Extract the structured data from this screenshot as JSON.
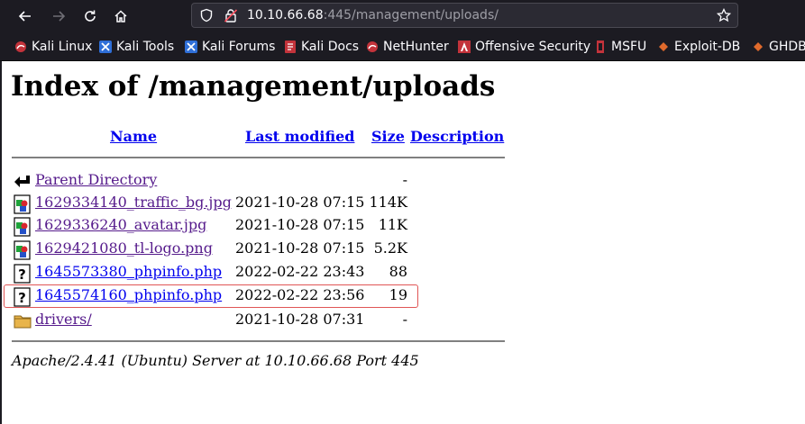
{
  "browser": {
    "url_host": "10.10.66.68",
    "url_path": ":445/management/uploads/",
    "bookmarks": [
      {
        "label": "Kali Linux",
        "icon": "kali-icon"
      },
      {
        "label": "Kali Tools",
        "icon": "kali-tools-icon"
      },
      {
        "label": "Kali Forums",
        "icon": "kali-forums-icon"
      },
      {
        "label": "Kali Docs",
        "icon": "kali-docs-icon"
      },
      {
        "label": "NetHunter",
        "icon": "nethunter-icon"
      },
      {
        "label": "Offensive Security",
        "icon": "offsec-icon"
      },
      {
        "label": "MSFU",
        "icon": "msfu-icon"
      },
      {
        "label": "Exploit-DB",
        "icon": "exploitdb-icon"
      },
      {
        "label": "GHDB",
        "icon": "ghdb-icon"
      }
    ]
  },
  "page": {
    "title": "Index of /management/uploads",
    "columns": {
      "name": "Name",
      "modified": "Last modified",
      "size": "Size",
      "description": "Description"
    },
    "rows": [
      {
        "icon": "back-icon",
        "name": "Parent Directory",
        "modified": "",
        "size": "-",
        "visited": true
      },
      {
        "icon": "image-icon",
        "name": "1629334140_traffic_bg.jpg",
        "modified": "2021-10-28 07:15",
        "size": "114K",
        "visited": true
      },
      {
        "icon": "image-icon",
        "name": "1629336240_avatar.jpg",
        "modified": "2021-10-28 07:15",
        "size": "11K",
        "visited": true
      },
      {
        "icon": "image-icon",
        "name": "1629421080_tl-logo.png",
        "modified": "2021-10-28 07:15",
        "size": "5.2K",
        "visited": true
      },
      {
        "icon": "unknown-file-icon",
        "name": "1645573380_phpinfo.php",
        "modified": "2022-02-22 23:43",
        "size": "88",
        "visited": false
      },
      {
        "icon": "unknown-file-icon",
        "name": "1645574160_phpinfo.php",
        "modified": "2022-02-22 23:56",
        "size": "19",
        "visited": false
      },
      {
        "icon": "folder-icon",
        "name": "drivers/",
        "modified": "2021-10-28 07:31",
        "size": "-",
        "visited": true
      }
    ],
    "footer": "Apache/2.4.41 (Ubuntu) Server at 10.10.66.68 Port 445"
  },
  "colors": {
    "chrome": "#1c1b22",
    "link": "#0000ee",
    "visited": "#551a8b",
    "highlight": "#e05555"
  }
}
